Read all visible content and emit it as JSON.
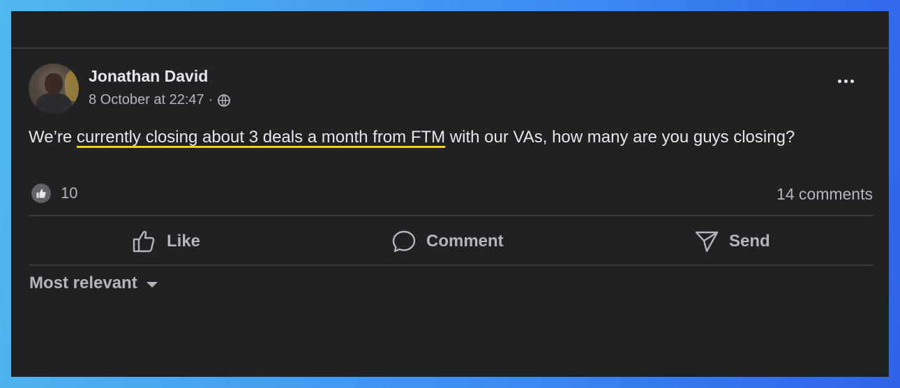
{
  "post": {
    "author": "Jonathan David",
    "timestamp": "8 October at 22:47",
    "separator": "·",
    "audience_icon": "globe-icon",
    "text_before": "We’re ",
    "text_highlighted": "currently closing about 3 deals a month from FTM",
    "text_after": " with our VAs, how many are you guys closing?",
    "highlight_color": "#f2d21b",
    "reaction_icon": "thumbs-up-icon",
    "reaction_count": "10",
    "comment_count": "14 comments"
  },
  "actions": {
    "like_label": "Like",
    "comment_label": "Comment",
    "send_label": "Send"
  },
  "comments": {
    "sort_label": "Most relevant"
  },
  "colors": {
    "background": "#202123",
    "text_primary": "#e6e7eb",
    "text_secondary": "#b4b6bb",
    "frame_gradient": [
      "#4fb8ee",
      "#2f63ea"
    ]
  }
}
